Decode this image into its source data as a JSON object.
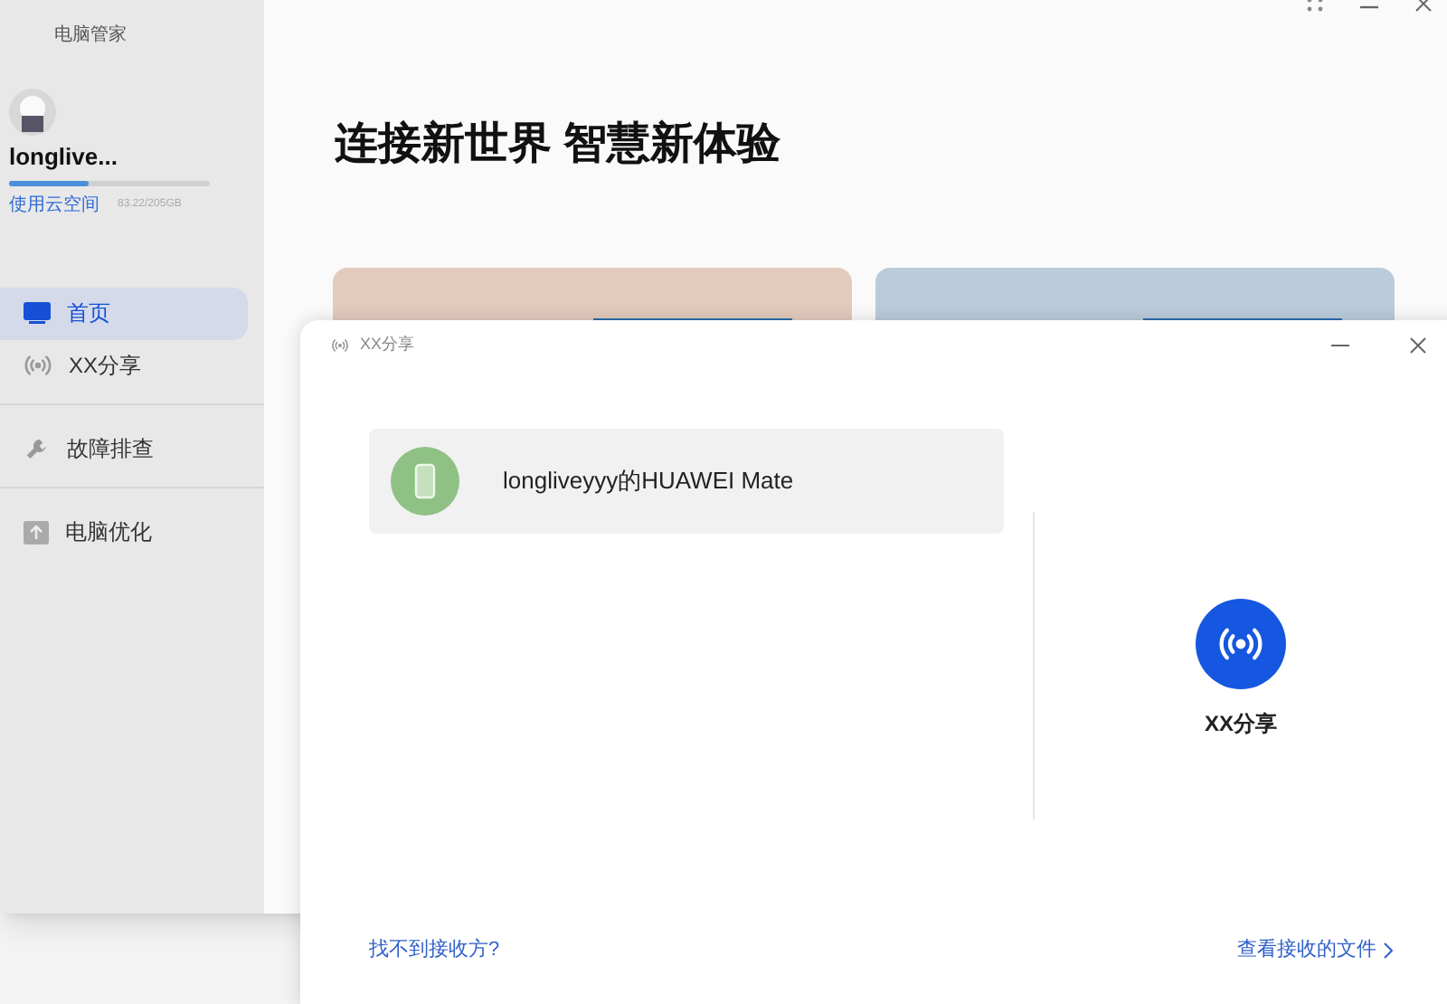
{
  "app": {
    "title": "电脑管家"
  },
  "user": {
    "name": "longlive...",
    "cloud_link": "使用云空间",
    "storage": "83.22/205GB",
    "level": 0.4
  },
  "sidebar": {
    "items": [
      {
        "label": "首页",
        "kind": "monitor",
        "selected": true
      },
      {
        "label": "XX分享",
        "kind": "share",
        "selected": false
      },
      {
        "label": "故障排查",
        "kind": "wrench",
        "selected": false
      },
      {
        "label": "电脑优化",
        "kind": "optimize",
        "selected": false
      }
    ]
  },
  "main": {
    "headline": "连接新世界 智慧新体验"
  },
  "dialog": {
    "title": "XX分享",
    "device": "longliveyyy的HUAWEI Mate",
    "share_label": "XX分享",
    "help_link": "找不到接收方?",
    "files_link": "查看接收的文件"
  }
}
